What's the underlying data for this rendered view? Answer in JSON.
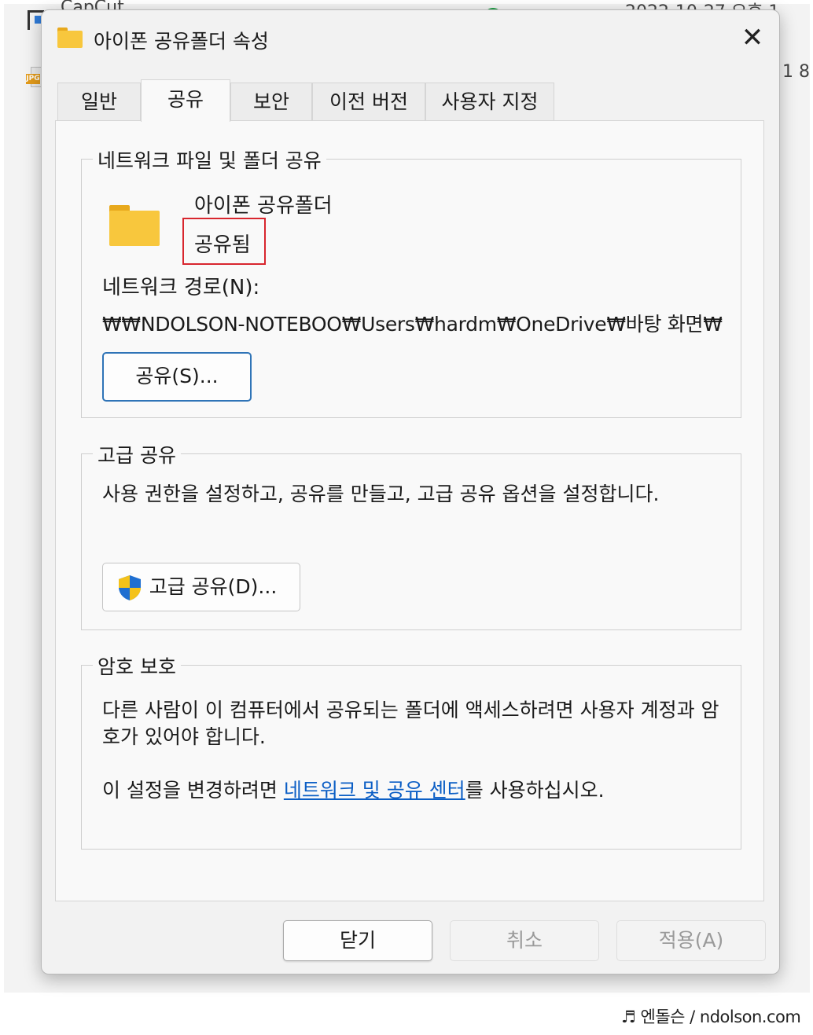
{
  "background": {
    "row1_name": "CapCut",
    "row1_date": "2022-10-27 오후 1",
    "row2_trail": "1 8"
  },
  "dialog": {
    "title": "아이폰 공유폴더 속성",
    "close_label": "✕",
    "tabs": [
      {
        "label": "일반",
        "active": false
      },
      {
        "label": "공유",
        "active": true
      },
      {
        "label": "보안",
        "active": false
      },
      {
        "label": "이전 버전",
        "active": false
      },
      {
        "label": "사용자 지정",
        "active": false
      }
    ],
    "network_share": {
      "group_title": "네트워크 파일 및 폴더 공유",
      "folder_name": "아이폰 공유폴더",
      "status": "공유됨",
      "path_label": "네트워크 경로(N):",
      "path_value": "₩₩NDOLSON-NOTEBOO₩Users₩hardm₩OneDrive₩바탕 화면₩",
      "share_button": "공유(S)..."
    },
    "advanced_share": {
      "group_title": "고급 공유",
      "description": "사용 권한을 설정하고, 공유를 만들고, 고급 공유 옵션을 설정합니다.",
      "button": "고급 공유(D)..."
    },
    "password": {
      "group_title": "암호 보호",
      "description": "다른 사람이 이 컴퓨터에서 공유되는 폴더에 액세스하려면 사용자 계정과 암호가 있어야 합니다.",
      "change_prefix": "이 설정을 변경하려면 ",
      "link_text": "네트워크 및 공유 센터",
      "change_suffix": "를 사용하십시오."
    },
    "footer": {
      "ok": "닫기",
      "cancel": "취소",
      "apply": "적용(A)"
    }
  },
  "watermark": "♬ 엔돌슨 / ndolson.com",
  "colors": {
    "highlight_border": "#d8262e",
    "link": "#0b5ec5",
    "primary_button_border": "#2f74b7",
    "folder_yellow": "#f8c73d"
  }
}
